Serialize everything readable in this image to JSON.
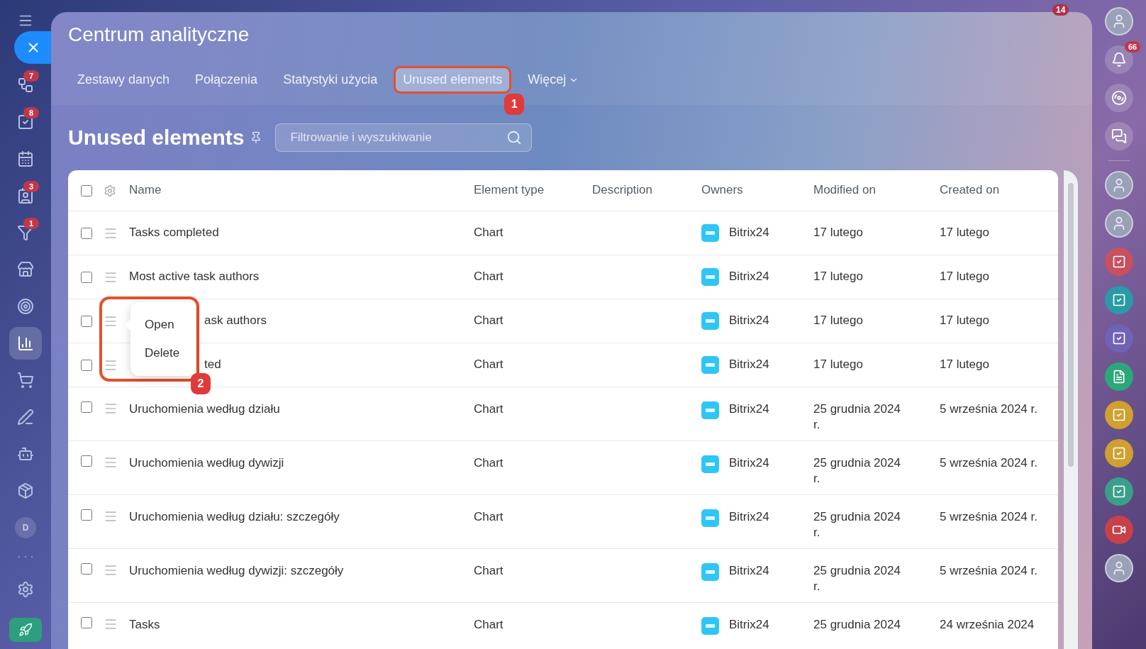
{
  "window": {
    "title": "Centrum analityczne"
  },
  "tabs": [
    {
      "label": "Zestawy danych",
      "selected": false
    },
    {
      "label": "Połączenia",
      "selected": false
    },
    {
      "label": "Statystyki użycia",
      "selected": false
    },
    {
      "label": "Unused elements",
      "selected": true,
      "callout": "1"
    },
    {
      "label": "Więcej",
      "selected": false,
      "dropdown": true
    }
  ],
  "page_heading": "Unused elements",
  "search": {
    "placeholder": "Filtrowanie i wyszukiwanie"
  },
  "left_sidebar": {
    "items": [
      {
        "kind": "icon",
        "badge": "7",
        "selected": false
      },
      {
        "kind": "icon",
        "badge": "8",
        "selected": false
      },
      {
        "kind": "icon",
        "selected": false
      },
      {
        "kind": "icon",
        "badge": "3",
        "selected": false
      },
      {
        "kind": "icon",
        "badge": "1",
        "selected": false
      },
      {
        "kind": "icon",
        "selected": false
      },
      {
        "kind": "icon",
        "selected": false
      },
      {
        "kind": "icon",
        "selected": true
      },
      {
        "kind": "icon",
        "selected": false
      },
      {
        "kind": "icon",
        "selected": false
      },
      {
        "kind": "icon",
        "selected": false
      },
      {
        "kind": "icon",
        "selected": false
      },
      {
        "kind": "initial",
        "label": "D",
        "selected": false
      }
    ]
  },
  "right_sidebar": {
    "top_badge": "14",
    "notifications_badge": "66",
    "items": [
      {
        "kind": "avatar"
      },
      {
        "kind": "avatar"
      },
      {
        "kind": "task",
        "color": "#c9505e"
      },
      {
        "kind": "task",
        "color": "#2a9aa6"
      },
      {
        "kind": "task",
        "color": "#6f63b6"
      },
      {
        "kind": "doc",
        "color": "#2aa87a"
      },
      {
        "kind": "task",
        "color": "#d0a030"
      },
      {
        "kind": "task",
        "color": "#d0a030"
      },
      {
        "kind": "task",
        "color": "#3a9f8a"
      },
      {
        "kind": "video",
        "color": "#c8404a"
      },
      {
        "kind": "avatar"
      }
    ]
  },
  "table": {
    "select_all_checked": false,
    "columns": [
      "Name",
      "Element type",
      "Description",
      "Owners",
      "Modified on",
      "Created on"
    ],
    "rows": [
      {
        "checked": false,
        "name": "Tasks completed",
        "type": "Chart",
        "owner": "Bitrix24",
        "modified": "17 lutego",
        "created": "17 lutego"
      },
      {
        "checked": false,
        "name": "Most active task authors",
        "type": "Chart",
        "owner": "Bitrix24",
        "modified": "17 lutego",
        "created": "17 lutego"
      },
      {
        "checked": false,
        "menu_open": true,
        "name": "ask authors",
        "type": "Chart",
        "owner": "Bitrix24",
        "modified": "17 lutego",
        "created": "17 lutego"
      },
      {
        "checked": false,
        "name": "ted",
        "type": "Chart",
        "owner": "Bitrix24",
        "modified": "17 lutego",
        "created": "17 lutego"
      },
      {
        "checked": false,
        "name": "Uruchomienia według działu",
        "type": "Chart",
        "owner": "Bitrix24",
        "modified": "25 grudnia 2024 r.",
        "created": "5 września 2024 r."
      },
      {
        "checked": false,
        "name": "Uruchomienia według dywizji",
        "type": "Chart",
        "owner": "Bitrix24",
        "modified": "25 grudnia 2024 r.",
        "created": "5 września 2024 r."
      },
      {
        "checked": false,
        "name": "Uruchomienia według działu: szczegóły",
        "type": "Chart",
        "owner": "Bitrix24",
        "modified": "25 grudnia 2024 r.",
        "created": "5 września 2024 r."
      },
      {
        "checked": false,
        "name": "Uruchomienia według dywizji: szczegóły",
        "type": "Chart",
        "owner": "Bitrix24",
        "modified": "25 grudnia 2024 r.",
        "created": "5 września 2024 r."
      },
      {
        "checked": false,
        "name": "Tasks",
        "type": "Chart",
        "owner": "Bitrix24",
        "modified": "25 grudnia 2024",
        "created": "24 września 2024"
      }
    ]
  },
  "context_menu": {
    "items": [
      "Open",
      "Delete"
    ],
    "callout": "2"
  }
}
